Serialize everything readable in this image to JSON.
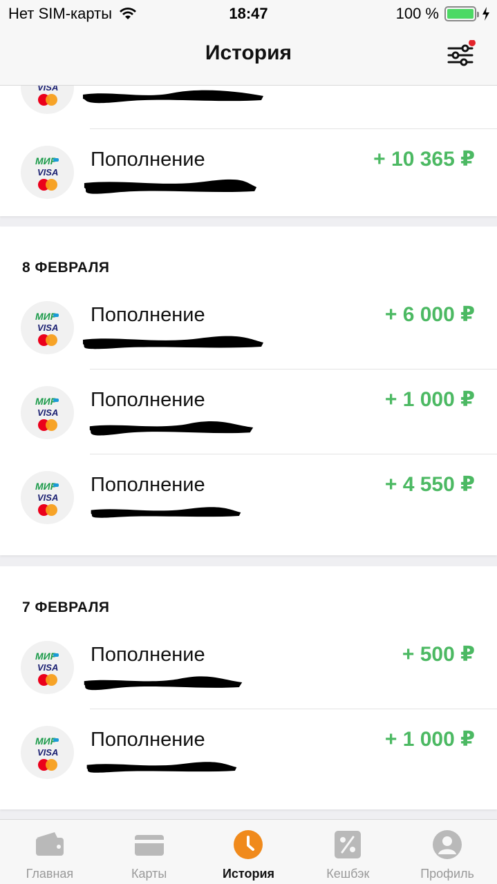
{
  "status_bar": {
    "carrier": "Нет SIM-карты",
    "time": "18:47",
    "battery": "100 %"
  },
  "header": {
    "title": "История",
    "filter_icon": "sliders-icon",
    "filter_badge_color": "#e3242b"
  },
  "colors": {
    "amount_positive": "#4cb963",
    "tab_active": "#f08a1c",
    "tab_inactive": "#b9b9b9"
  },
  "sections": [
    {
      "date": "",
      "transactions": [
        {
          "title": "",
          "amount": ""
        },
        {
          "title": "Пополнение",
          "amount": "+ 10 365 ₽"
        }
      ]
    },
    {
      "date": "8 ФЕВРАЛЯ",
      "transactions": [
        {
          "title": "Пополнение",
          "amount": "+ 6 000 ₽"
        },
        {
          "title": "Пополнение",
          "amount": "+ 1 000 ₽"
        },
        {
          "title": "Пополнение",
          "amount": "+ 4 550 ₽"
        }
      ]
    },
    {
      "date": "7 ФЕВРАЛЯ",
      "transactions": [
        {
          "title": "Пополнение",
          "amount": "+ 500 ₽"
        },
        {
          "title": "Пополнение",
          "amount": "+ 1 000 ₽"
        }
      ]
    }
  ],
  "card_logo": {
    "mir": "МИР",
    "visa": "VISA"
  },
  "tabbar": {
    "items": [
      {
        "label": "Главная",
        "icon": "wallet-icon"
      },
      {
        "label": "Карты",
        "icon": "card-icon"
      },
      {
        "label": "История",
        "icon": "clock-icon",
        "active": true
      },
      {
        "label": "Кешбэк",
        "icon": "percent-icon"
      },
      {
        "label": "Профиль",
        "icon": "profile-icon"
      }
    ]
  }
}
